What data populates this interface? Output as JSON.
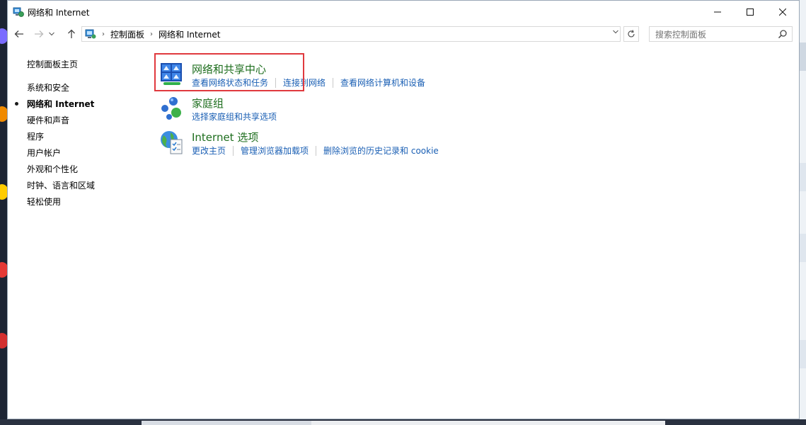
{
  "window": {
    "title": "网络和 Internet"
  },
  "address": {
    "breadcrumbs": [
      "控制面板",
      "网络和 Internet"
    ]
  },
  "search": {
    "placeholder": "搜索控制面板"
  },
  "sidebar": {
    "items": [
      {
        "label": "控制面板主页",
        "active": false
      },
      {
        "label": "系统和安全",
        "active": false
      },
      {
        "label": "网络和 Internet",
        "active": true
      },
      {
        "label": "硬件和声音",
        "active": false
      },
      {
        "label": "程序",
        "active": false
      },
      {
        "label": "用户帐户",
        "active": false
      },
      {
        "label": "外观和个性化",
        "active": false
      },
      {
        "label": "时钟、语言和区域",
        "active": false
      },
      {
        "label": "轻松使用",
        "active": false
      }
    ]
  },
  "categories": [
    {
      "title": "网络和共享中心",
      "icon": "network-sharing-icon",
      "links": [
        "查看网络状态和任务",
        "连接到网络",
        "查看网络计算机和设备"
      ]
    },
    {
      "title": "家庭组",
      "icon": "homegroup-icon",
      "links": [
        "选择家庭组和共享选项"
      ]
    },
    {
      "title": "Internet 选项",
      "icon": "internet-options-icon",
      "links": [
        "更改主页",
        "管理浏览器加载项",
        "删除浏览的历史记录和 cookie"
      ]
    }
  ],
  "colors": {
    "category_title": "#1e6e1e",
    "link": "#1a5fb4",
    "highlight": "#e0393e"
  }
}
